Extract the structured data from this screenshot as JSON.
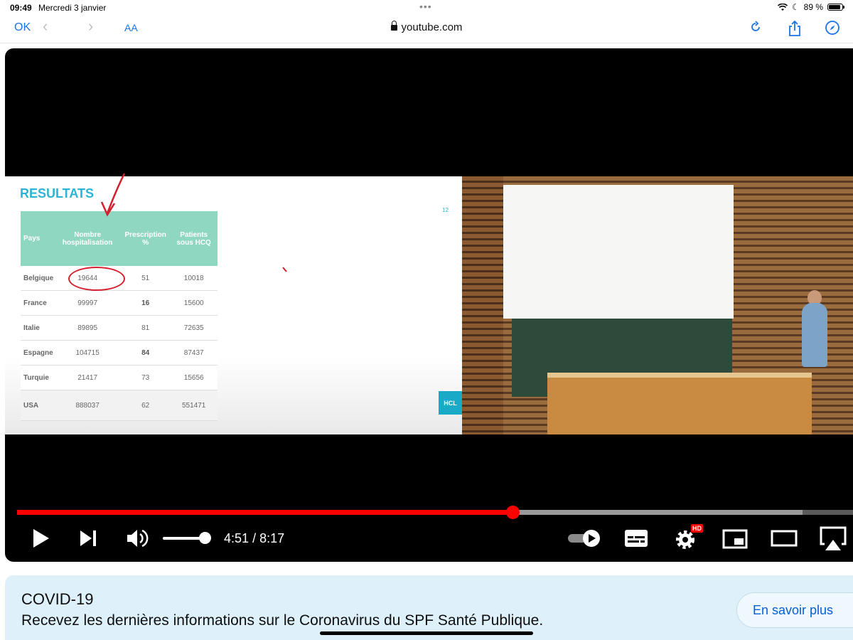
{
  "status_bar": {
    "time": "09:49",
    "date": "Mercredi 3 janvier",
    "battery": "89 %",
    "battery_level": 0.89
  },
  "browser": {
    "ok_label": "OK",
    "text_size_label": "AA",
    "url": "youtube.com"
  },
  "slide": {
    "title": "RESULTATS",
    "page_number": "12",
    "logo_text": "HCL",
    "table": {
      "headers": [
        "Pays",
        "Nombre hospitalisation",
        "Prescription %",
        "Patients sous HCQ"
      ],
      "rows": [
        [
          "Belgique",
          "19644",
          "51",
          "10018"
        ],
        [
          "France",
          "99997",
          "16",
          "15600"
        ],
        [
          "Italie",
          "89895",
          "81",
          "72635"
        ],
        [
          "Espagne",
          "104715",
          "84",
          "87437"
        ],
        [
          "Turquie",
          "21417",
          "73",
          "15656"
        ],
        [
          "USA",
          "888037",
          "62",
          "551471"
        ]
      ]
    }
  },
  "player": {
    "current_time": "4:51",
    "duration": "8:17",
    "time_separator": "/",
    "progress": 0.593,
    "buffered": 0.94,
    "volume": 0.9,
    "hd_badge": "HD",
    "colors": {
      "progress": "#ff0000",
      "accent": "#1a73e8"
    }
  },
  "banner": {
    "title": "COVID-19",
    "text": "Recevez les dernières informations sur le Coronavirus du SPF Santé Publique.",
    "button_label": "En savoir plus"
  }
}
